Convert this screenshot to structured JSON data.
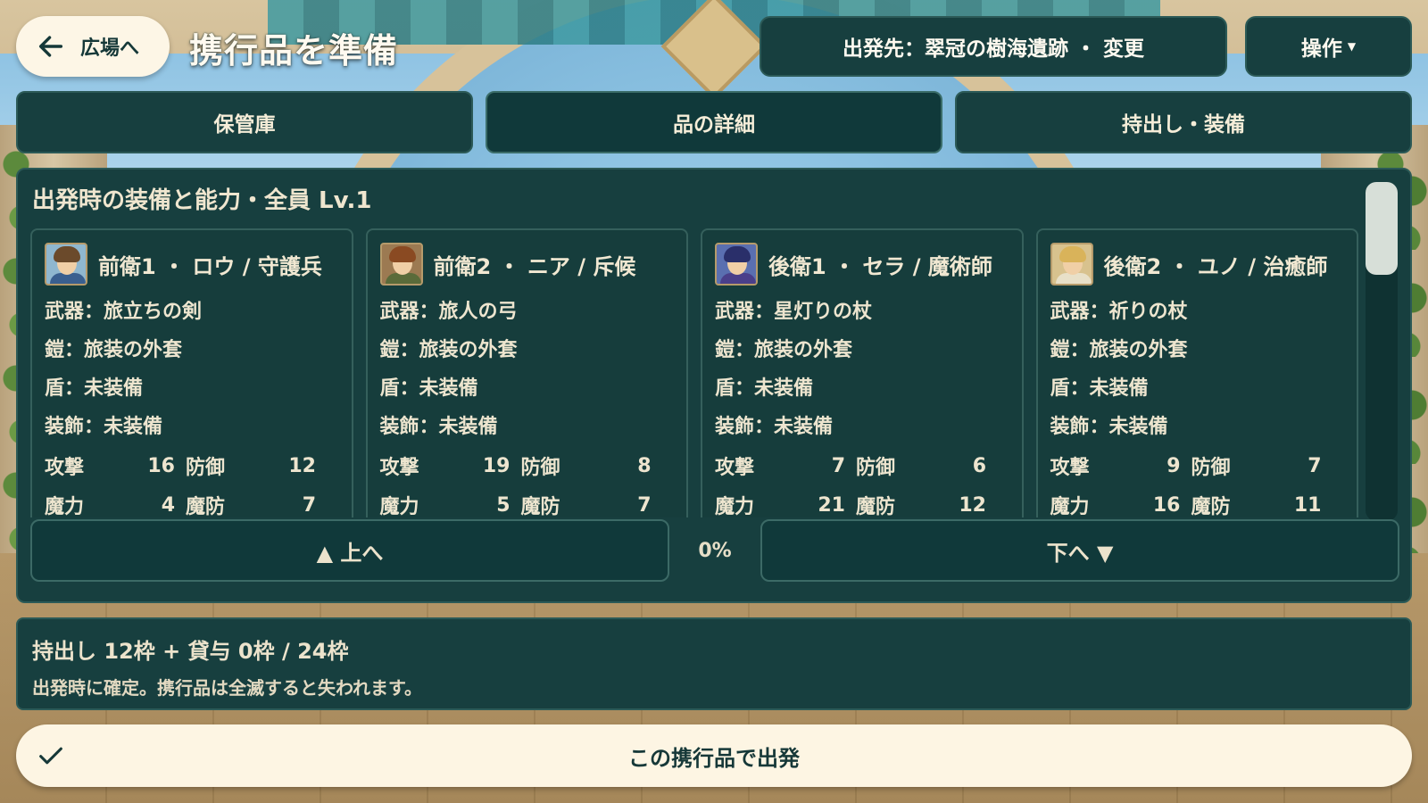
{
  "header": {
    "back_label": "広場へ",
    "title": "携行品を準備",
    "destination_label": "出発先：翠冠の樹海遺跡 ・ 変更",
    "ops_label": "操作"
  },
  "tabs": [
    {
      "label": "保管庫",
      "active": false
    },
    {
      "label": "品の詳細",
      "active": true
    },
    {
      "label": "持出し・装備",
      "active": false
    }
  ],
  "section": {
    "title": "出発時の装備と能力・全員 Lv.1",
    "scroll_up_label": "▲ 上へ",
    "scroll_down_label": "下へ ▼",
    "scroll_percent": "0%"
  },
  "party": [
    {
      "name": "前衛1 ・ ロウ / 守護兵",
      "weapon": "武器：旅立ちの剣",
      "armor": "鎧：旅装の外套",
      "shield": "盾：未装備",
      "accessory": "装飾：未装備",
      "atk_label": "攻撃",
      "atk": "16",
      "def_label": "防御",
      "def": "12",
      "mag_label": "魔力",
      "mag": "4",
      "mdef_label": "魔防",
      "mdef": "7",
      "colors": {
        "hair": "#6b4a2b",
        "body": "#3a5f8f",
        "bg": "#8fb7cf"
      }
    },
    {
      "name": "前衛2 ・ ニア / 斥候",
      "weapon": "武器：旅人の弓",
      "armor": "鎧：旅装の外套",
      "shield": "盾：未装備",
      "accessory": "装飾：未装備",
      "atk_label": "攻撃",
      "atk": "19",
      "def_label": "防御",
      "def": "8",
      "mag_label": "魔力",
      "mag": "5",
      "mdef_label": "魔防",
      "mdef": "7",
      "colors": {
        "hair": "#8a4a22",
        "body": "#5a6b3a",
        "bg": "#9c7a52"
      }
    },
    {
      "name": "後衛1 ・ セラ / 魔術師",
      "weapon": "武器：星灯りの杖",
      "armor": "鎧：旅装の外套",
      "shield": "盾：未装備",
      "accessory": "装飾：未装備",
      "atk_label": "攻撃",
      "atk": "7",
      "def_label": "防御",
      "def": "6",
      "mag_label": "魔力",
      "mag": "21",
      "mdef_label": "魔防",
      "mdef": "12",
      "colors": {
        "hair": "#2a2f6a",
        "body": "#4a3f8a",
        "bg": "#5a6fb0"
      }
    },
    {
      "name": "後衛2 ・ ユノ / 治癒師",
      "weapon": "武器：祈りの杖",
      "armor": "鎧：旅装の外套",
      "shield": "盾：未装備",
      "accessory": "装飾：未装備",
      "atk_label": "攻撃",
      "atk": "9",
      "def_label": "防御",
      "def": "7",
      "mag_label": "魔力",
      "mag": "16",
      "mdef_label": "魔防",
      "mdef": "11",
      "colors": {
        "hair": "#d9b35a",
        "body": "#e8e0c8",
        "bg": "#d8c28e"
      }
    }
  ],
  "footer": {
    "capacity": "持出し 12枠 + 貸与 0枠 / 24枠",
    "note": "出発時に確定。携行品は全滅すると失われます。",
    "depart_label": "この携行品で出発"
  },
  "icons": {
    "back": "arrow-left-icon",
    "depart": "check-icon",
    "ops": "caret-down-icon"
  }
}
